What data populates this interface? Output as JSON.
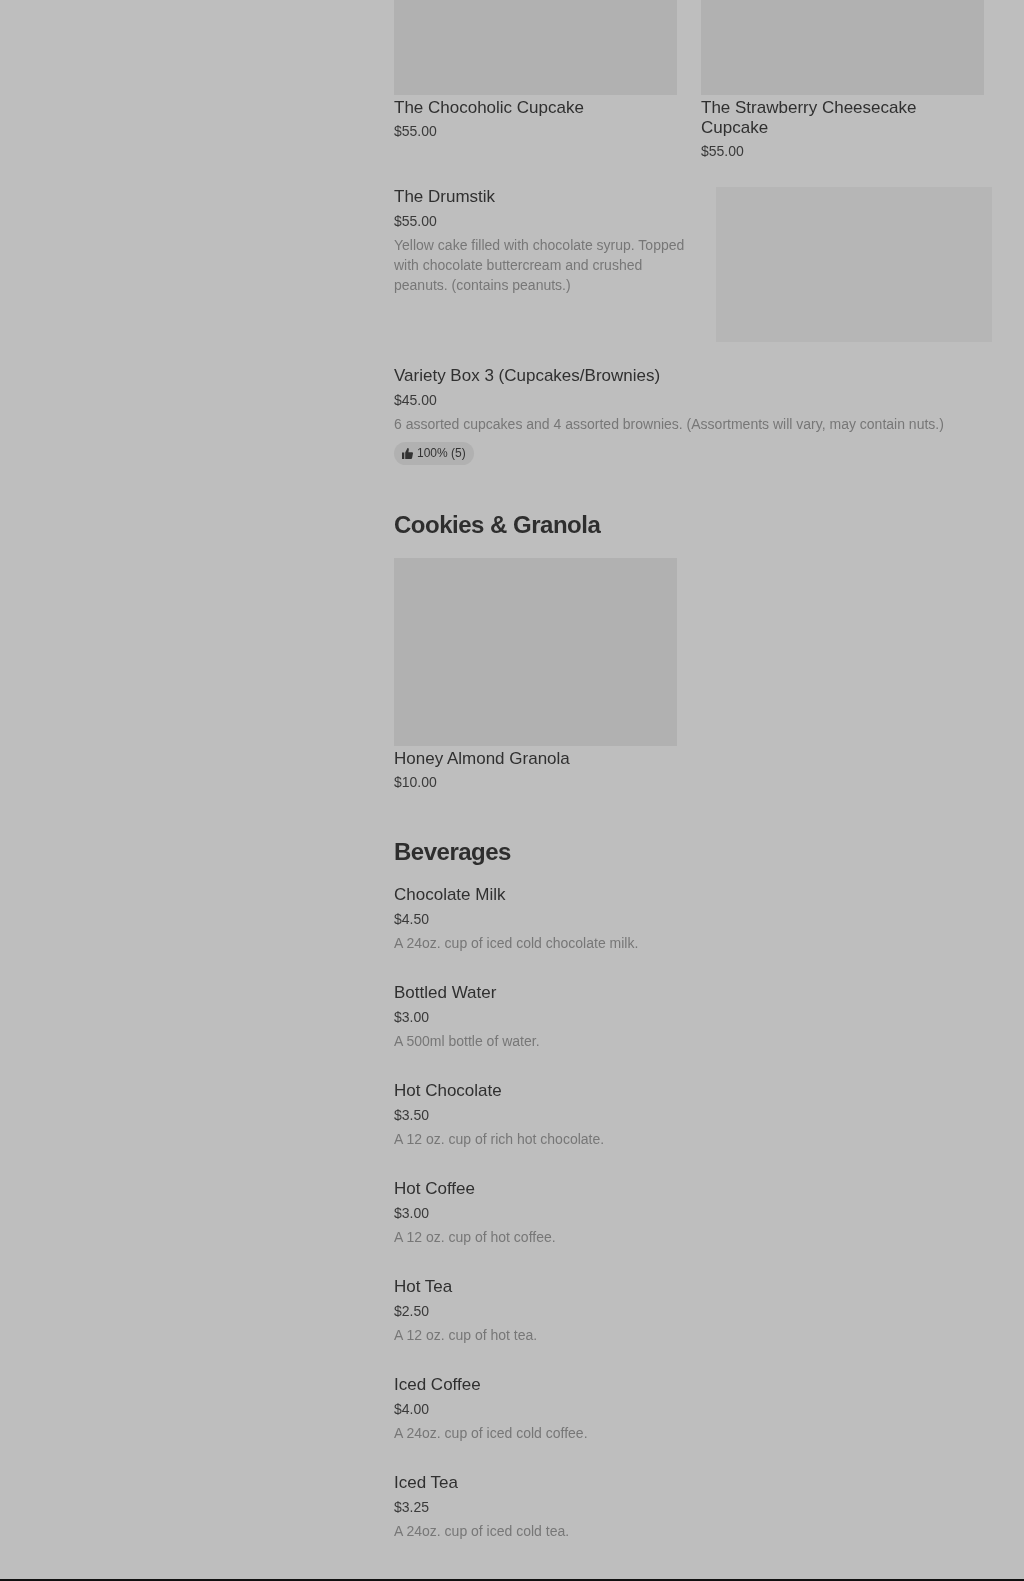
{
  "sections": [
    {
      "items": [
        {
          "kind": "tile",
          "name": "The Chocoholic Cupcake",
          "price": "$55.00"
        },
        {
          "kind": "tile",
          "name": "The Strawberry Cheesecake Cupcake",
          "price": "$55.00"
        },
        {
          "kind": "row",
          "name": "The Drumstik",
          "price": "$55.00",
          "description": "Yellow cake filled with chocolate syrup. Topped with chocolate buttercream and crushed peanuts. (contains peanuts.)",
          "image": true
        },
        {
          "kind": "row",
          "name": "Variety Box 3 (Cupcakes/Brownies)",
          "price": "$45.00",
          "description": "6 assorted cupcakes and 4 assorted brownies. (Assortments will vary, may contain nuts.)",
          "rating": "100% (5)"
        }
      ]
    },
    {
      "title": "Cookies & Granola",
      "items": [
        {
          "kind": "tile",
          "name": "Honey Almond Granola",
          "price": "$10.00"
        }
      ]
    },
    {
      "title": "Beverages",
      "items": [
        {
          "kind": "row",
          "name": "Chocolate Milk",
          "price": "$4.50",
          "description": "A 24oz. cup of iced cold chocolate milk."
        },
        {
          "kind": "row",
          "name": "Bottled Water",
          "price": "$3.00",
          "description": "A 500ml bottle of water."
        },
        {
          "kind": "row",
          "name": "Hot Chocolate",
          "price": "$3.50",
          "description": "A 12 oz. cup of rich hot chocolate."
        },
        {
          "kind": "row",
          "name": "Hot Coffee",
          "price": "$3.00",
          "description": "A 12 oz. cup of hot coffee."
        },
        {
          "kind": "row",
          "name": "Hot Tea",
          "price": "$2.50",
          "description": "A 12 oz. cup of hot tea."
        },
        {
          "kind": "row",
          "name": "Iced Coffee",
          "price": "$4.00",
          "description": "A 24oz. cup of iced cold coffee."
        },
        {
          "kind": "row",
          "name": "Iced Tea",
          "price": "$3.25",
          "description": "A 24oz. cup of iced cold tea."
        }
      ]
    }
  ]
}
